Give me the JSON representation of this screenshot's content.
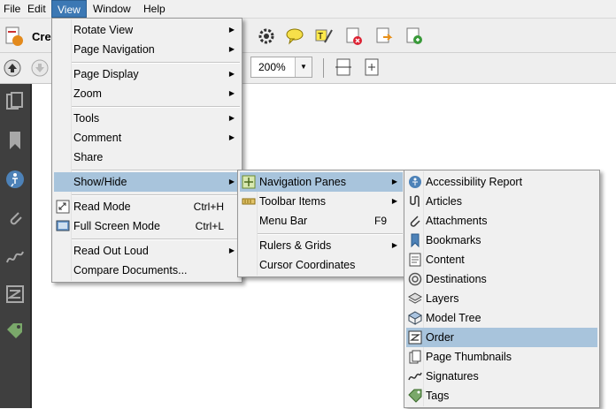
{
  "menubar": {
    "file": "File",
    "edit": "Edit",
    "view": "View",
    "window": "Window",
    "help": "Help"
  },
  "toolbar": {
    "create_label": "Crea",
    "zoom_value": "200%"
  },
  "view_menu": {
    "items": [
      {
        "label": "Rotate View"
      },
      {
        "label": "Page Navigation"
      },
      {
        "label": "Page Display"
      },
      {
        "label": "Zoom"
      },
      {
        "label": "Tools"
      },
      {
        "label": "Comment"
      },
      {
        "label": "Share"
      },
      {
        "label": "Show/Hide"
      },
      {
        "label": "Read Mode",
        "shortcut": "Ctrl+H"
      },
      {
        "label": "Full Screen Mode",
        "shortcut": "Ctrl+L"
      },
      {
        "label": "Read Out Loud"
      },
      {
        "label": "Compare Documents..."
      }
    ]
  },
  "showhide_menu": {
    "items": [
      {
        "label": "Navigation Panes"
      },
      {
        "label": "Toolbar Items"
      },
      {
        "label": "Menu Bar",
        "shortcut": "F9"
      },
      {
        "label": "Rulers & Grids"
      },
      {
        "label": "Cursor Coordinates"
      }
    ]
  },
  "navpanes_menu": {
    "items": [
      {
        "label": "Accessibility Report"
      },
      {
        "label": "Articles"
      },
      {
        "label": "Attachments"
      },
      {
        "label": "Bookmarks"
      },
      {
        "label": "Content"
      },
      {
        "label": "Destinations"
      },
      {
        "label": "Layers"
      },
      {
        "label": "Model Tree"
      },
      {
        "label": "Order"
      },
      {
        "label": "Page Thumbnails"
      },
      {
        "label": "Signatures"
      },
      {
        "label": "Tags"
      }
    ]
  },
  "colors": {
    "menu_active": "#3c78b4",
    "highlight": "#a8c4dc",
    "menu_bg": "#f0f0f0",
    "left_panel": "#3f3f3f"
  }
}
